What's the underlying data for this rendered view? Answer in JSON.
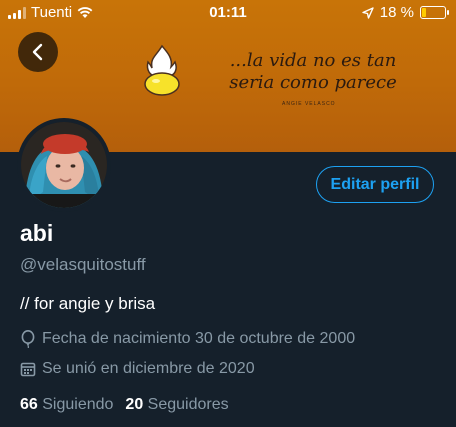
{
  "status_bar": {
    "carrier": "Tuenti",
    "time": "01:11",
    "battery_text": "18 %",
    "battery_level": 0.18,
    "icons": [
      "signal-icon",
      "wifi-icon",
      "location-arrow-icon",
      "battery-icon"
    ]
  },
  "header": {
    "banner_text_line1": "...la vida no es tan",
    "banner_text_line2": "seria como parece",
    "banner_credit": "ANGIE VELASCO",
    "back_icon": "chevron-left-icon"
  },
  "profile": {
    "display_name": "abi",
    "handle": "@velasquitostuff",
    "bio": "// for angie y brisa",
    "birthday": "Fecha de nacimiento 30 de octubre de 2000",
    "joined": "Se unió en diciembre de 2020",
    "following_count": "66",
    "following_label": "Siguiendo",
    "followers_count": "20",
    "followers_label": "Seguidores",
    "edit_button_label": "Editar perfil"
  },
  "colors": {
    "background": "#15202b",
    "banner": "#c06a09",
    "accent": "#1da1f2",
    "secondary_text": "#8899a6"
  }
}
